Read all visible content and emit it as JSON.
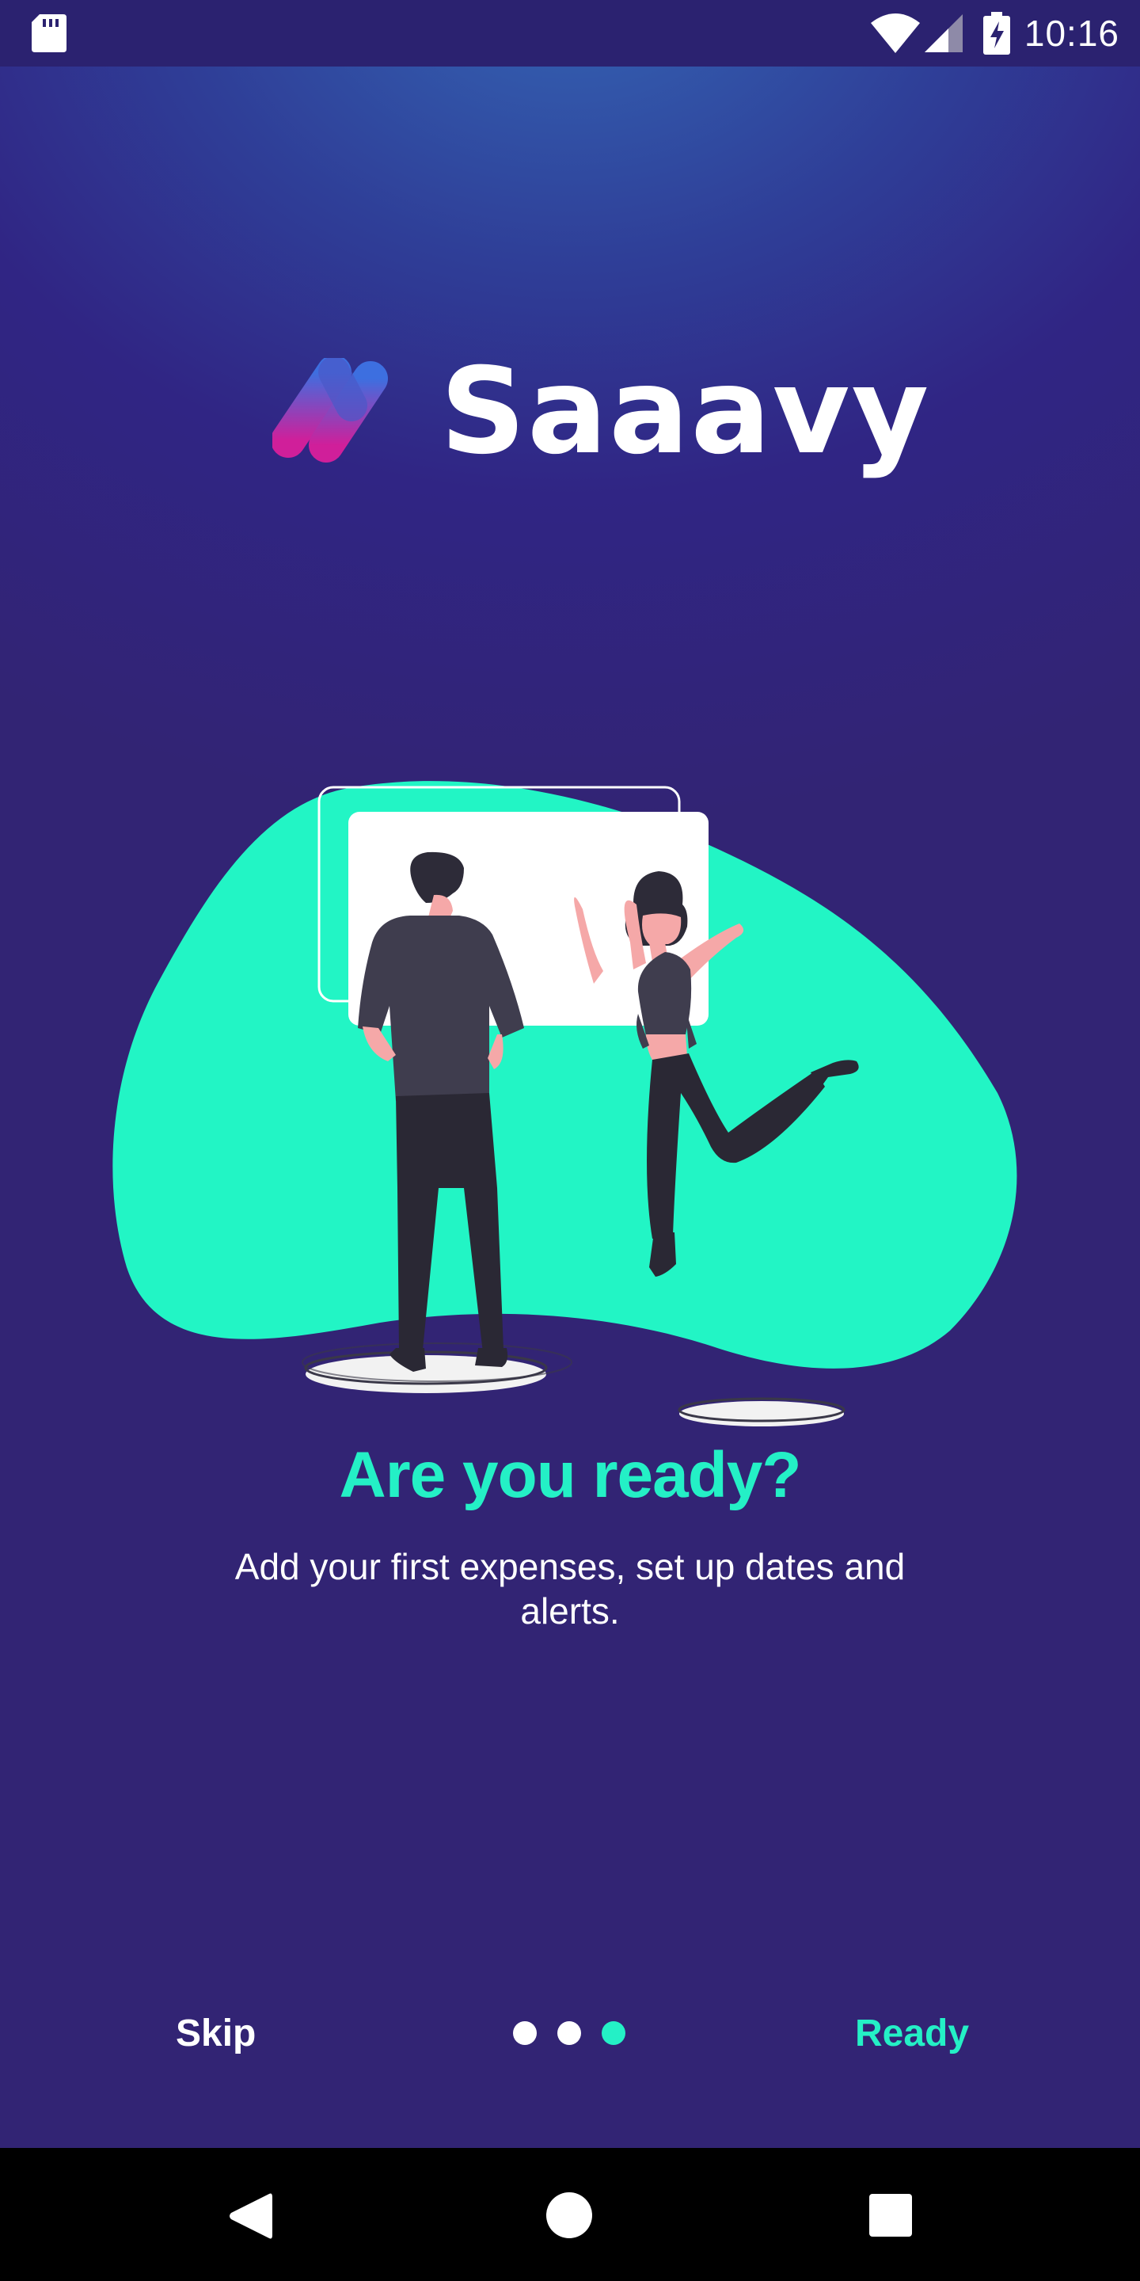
{
  "status_bar": {
    "time": "10:16",
    "icons": [
      "sd-card-icon",
      "wifi-icon",
      "signal-icon",
      "battery-charging-icon"
    ]
  },
  "app": {
    "name": "Saaavy",
    "logo_icon": "saaavy-logo-icon"
  },
  "onboarding": {
    "headline": "Are you ready?",
    "description": "Add your first expenses, set up dates and alerts.",
    "page_indicator": {
      "total_pages": 3,
      "active_page": 3
    },
    "skip_label": "Skip",
    "ready_label": "Ready"
  },
  "nav_bar": {
    "icons": [
      "back-icon",
      "home-icon",
      "recent-apps-icon"
    ]
  },
  "colors": {
    "accent": "#24f0c6",
    "background_top": "#3467b6",
    "background_bottom": "#322474",
    "dot_inactive": "#ffffff",
    "dot_active": "#24f0c6",
    "logo_gradient_top": "#3d6fe0",
    "logo_gradient_bottom": "#d01f9a",
    "status_bar": "#2b2270",
    "nav_bar": "#000000"
  }
}
